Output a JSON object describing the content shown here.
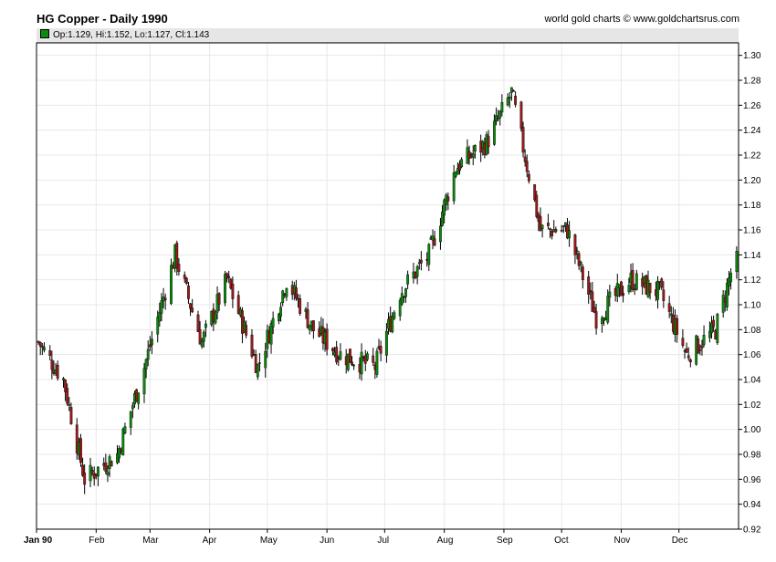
{
  "header": {
    "title": "HG Copper - Daily 1990",
    "credit": "world gold charts © www.goldchartsrus.com"
  },
  "legend": {
    "ohlc_text": "Op:1.129, Hi:1.152, Lo:1.127, Cl:1.143",
    "swatch_color": "#0b8a0b"
  },
  "colors": {
    "up": "#0b8a0b",
    "down": "#9c1a1a",
    "wick": "#000000",
    "grid": "#e8e8e8"
  },
  "chart_data": {
    "type": "candlestick",
    "title": "HG Copper - Daily 1990",
    "ylim": [
      0.92,
      1.31
    ],
    "yticks": [
      0.92,
      0.94,
      0.96,
      0.98,
      1.0,
      1.02,
      1.04,
      1.06,
      1.08,
      1.1,
      1.12,
      1.14,
      1.16,
      1.18,
      1.2,
      1.22,
      1.24,
      1.26,
      1.28,
      1.3
    ],
    "x_axis_labels": [
      "Jan 90",
      "Feb",
      "Mar",
      "Apr",
      "May",
      "Jun",
      "Jul",
      "Aug",
      "Sep",
      "Oct",
      "Nov",
      "Dec"
    ],
    "x_axis_label_days": [
      0,
      31,
      59,
      90,
      120,
      151,
      181,
      212,
      243,
      273,
      304,
      334
    ],
    "x_range_days": [
      0,
      365
    ],
    "grid": true,
    "legend_position": "top",
    "approximate_daily_closes": [
      {
        "date": "1990-01-02",
        "close": 1.07
      },
      {
        "date": "1990-01-15",
        "close": 1.04
      },
      {
        "date": "1990-01-26",
        "close": 0.96
      },
      {
        "date": "1990-02-12",
        "close": 0.98
      },
      {
        "date": "1990-02-26",
        "close": 1.05
      },
      {
        "date": "1990-03-14",
        "close": 1.14
      },
      {
        "date": "1990-03-28",
        "close": 1.07
      },
      {
        "date": "1990-04-10",
        "close": 1.12
      },
      {
        "date": "1990-04-26",
        "close": 1.05
      },
      {
        "date": "1990-05-11",
        "close": 1.12
      },
      {
        "date": "1990-05-25",
        "close": 1.08
      },
      {
        "date": "1990-06-08",
        "close": 1.06
      },
      {
        "date": "1990-06-26",
        "close": 1.05
      },
      {
        "date": "1990-07-09",
        "close": 1.11
      },
      {
        "date": "1990-07-24",
        "close": 1.14
      },
      {
        "date": "1990-08-07",
        "close": 1.21
      },
      {
        "date": "1990-08-23",
        "close": 1.23
      },
      {
        "date": "1990-09-05",
        "close": 1.27
      },
      {
        "date": "1990-09-20",
        "close": 1.16
      },
      {
        "date": "1990-10-04",
        "close": 1.16
      },
      {
        "date": "1990-10-19",
        "close": 1.09
      },
      {
        "date": "1990-11-06",
        "close": 1.12
      },
      {
        "date": "1990-11-21",
        "close": 1.11
      },
      {
        "date": "1990-12-05",
        "close": 1.06
      },
      {
        "date": "1990-12-20",
        "close": 1.08
      },
      {
        "date": "1990-12-31",
        "close": 1.143
      }
    ]
  }
}
